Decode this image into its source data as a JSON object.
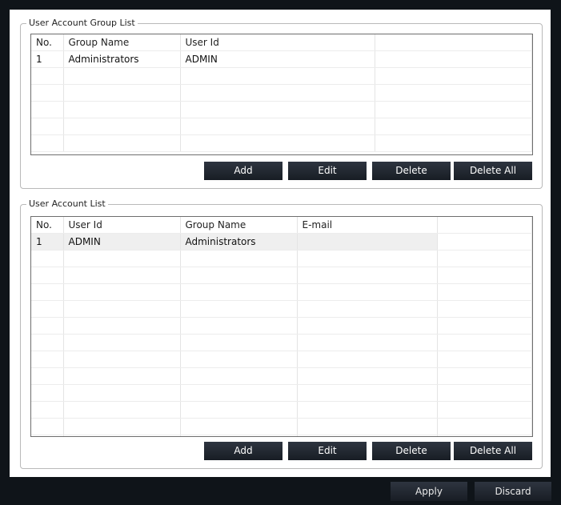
{
  "group_list": {
    "title": "User Account Group List",
    "columns": [
      "No.",
      "Group Name",
      "User Id",
      ""
    ],
    "rows": [
      [
        "1",
        "Administrators",
        "ADMIN",
        ""
      ],
      [
        "",
        "",
        "",
        ""
      ],
      [
        "",
        "",
        "",
        ""
      ],
      [
        "",
        "",
        "",
        ""
      ],
      [
        "",
        "",
        "",
        ""
      ],
      [
        "",
        "",
        "",
        ""
      ]
    ],
    "buttons": {
      "add": "Add",
      "edit": "Edit",
      "delete": "Delete",
      "delete_all": "Delete All"
    }
  },
  "account_list": {
    "title": "User Account List",
    "columns": [
      "No.",
      "User Id",
      "Group Name",
      "E-mail",
      ""
    ],
    "rows": [
      [
        "1",
        "ADMIN",
        "Administrators",
        "",
        ""
      ],
      [
        "",
        "",
        "",
        "",
        ""
      ],
      [
        "",
        "",
        "",
        "",
        ""
      ],
      [
        "",
        "",
        "",
        "",
        ""
      ],
      [
        "",
        "",
        "",
        "",
        ""
      ],
      [
        "",
        "",
        "",
        "",
        ""
      ],
      [
        "",
        "",
        "",
        "",
        ""
      ],
      [
        "",
        "",
        "",
        "",
        ""
      ],
      [
        "",
        "",
        "",
        "",
        ""
      ],
      [
        "",
        "",
        "",
        "",
        ""
      ],
      [
        "",
        "",
        "",
        "",
        ""
      ],
      [
        "",
        "",
        "",
        "",
        ""
      ],
      [
        "",
        "",
        "",
        "",
        ""
      ]
    ],
    "buttons": {
      "add": "Add",
      "edit": "Edit",
      "delete": "Delete",
      "delete_all": "Delete All"
    }
  },
  "footer": {
    "apply": "Apply",
    "discard": "Discard"
  }
}
